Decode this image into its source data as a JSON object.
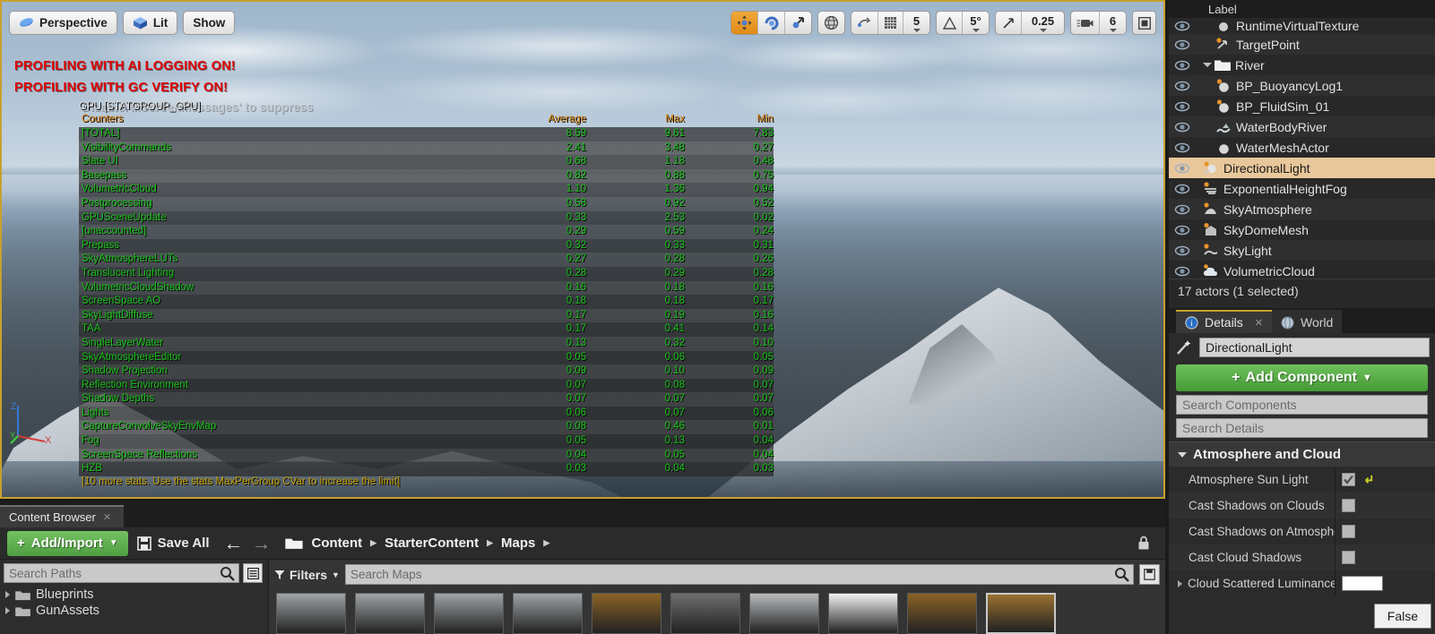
{
  "viewport": {
    "toolbar_left": [
      {
        "label": "Perspective",
        "icon": "camera-perspective-icon"
      },
      {
        "label": "Lit",
        "icon": "lit-cube-icon"
      },
      {
        "label": "Show",
        "icon": "show-icon"
      }
    ],
    "transform_tools": [
      {
        "name": "select-move-tool",
        "icon": "move-arrows-icon",
        "active": true
      },
      {
        "name": "rotate-tool",
        "icon": "rotate-icon",
        "active": false
      },
      {
        "name": "scale-tool",
        "icon": "scale-icon",
        "active": false
      }
    ],
    "coordinate_system": {
      "name": "world-coordinate-toggle",
      "icon": "globe-icon"
    },
    "surface_snap": {
      "name": "surface-snap-toggle",
      "icon": "surface-snap-icon"
    },
    "grid_snap": {
      "name": "grid-snap-toggle",
      "icon": "grid-icon",
      "value": "5"
    },
    "angle_snap": {
      "name": "angle-snap-toggle",
      "icon": "angle-icon",
      "value": "5°"
    },
    "scale_snap": {
      "name": "scale-snap-toggle",
      "icon": "scale-snap-icon",
      "value": "0.25"
    },
    "camera_speed": {
      "name": "camera-speed",
      "icon": "camera-speed-icon",
      "value": "6"
    },
    "maximize": {
      "name": "maximize-viewport-button",
      "icon": "maximize-icon"
    },
    "warnings": [
      "PROFILING WITH AI LOGGING ON!",
      "PROFILING WITH GC VERIFY ON!"
    ],
    "suppress_message": "'DisableAllScreenMessages' to suppress",
    "axis_labels": {
      "z": "Z",
      "y": "Y",
      "x": "X"
    }
  },
  "stats": {
    "title": "GPU [STATGROUP_GPU]",
    "columns": [
      "Counters",
      "Average",
      "Max",
      "Min"
    ],
    "rows": [
      {
        "name": "[TOTAL]",
        "average": "8.59",
        "max": "9.61",
        "min": "7.83"
      },
      {
        "name": "VisibilityCommands",
        "average": "2.41",
        "max": "3.48",
        "min": "0.27"
      },
      {
        "name": "Slate UI",
        "average": "0.68",
        "max": "1.18",
        "min": "0.48"
      },
      {
        "name": "Basepass",
        "average": "0.82",
        "max": "0.88",
        "min": "0.75"
      },
      {
        "name": "VolumetricCloud",
        "average": "1.10",
        "max": "1.36",
        "min": "0.94"
      },
      {
        "name": "Postprocessing",
        "average": "0.58",
        "max": "0.92",
        "min": "0.52"
      },
      {
        "name": "GPUSceneUpdate",
        "average": "0.33",
        "max": "2.53",
        "min": "0.02"
      },
      {
        "name": "[unaccounted]",
        "average": "0.29",
        "max": "0.59",
        "min": "0.24"
      },
      {
        "name": "Prepass",
        "average": "0.32",
        "max": "0.33",
        "min": "0.31"
      },
      {
        "name": "SkyAtmosphereLUTs",
        "average": "0.27",
        "max": "0.28",
        "min": "0.26"
      },
      {
        "name": "Translucent Lighting",
        "average": "0.28",
        "max": "0.29",
        "min": "0.28"
      },
      {
        "name": "VolumetricCloudShadow",
        "average": "0.16",
        "max": "0.18",
        "min": "0.16"
      },
      {
        "name": "ScreenSpace AO",
        "average": "0.18",
        "max": "0.18",
        "min": "0.17"
      },
      {
        "name": "SkyLightDiffuse",
        "average": "0.17",
        "max": "0.19",
        "min": "0.16"
      },
      {
        "name": "TAA",
        "average": "0.17",
        "max": "0.41",
        "min": "0.14"
      },
      {
        "name": "SingleLayerWater",
        "average": "0.13",
        "max": "0.32",
        "min": "0.10"
      },
      {
        "name": "SkyAtmosphereEditor",
        "average": "0.05",
        "max": "0.06",
        "min": "0.05"
      },
      {
        "name": "Shadow Projection",
        "average": "0.09",
        "max": "0.10",
        "min": "0.09"
      },
      {
        "name": "Reflection Environment",
        "average": "0.07",
        "max": "0.08",
        "min": "0.07"
      },
      {
        "name": "Shadow Depths",
        "average": "0.07",
        "max": "0.07",
        "min": "0.07"
      },
      {
        "name": "Lights",
        "average": "0.06",
        "max": "0.07",
        "min": "0.06"
      },
      {
        "name": "CaptureConvolveSkyEnvMap",
        "average": "0.08",
        "max": "0.46",
        "min": "0.01"
      },
      {
        "name": "Fog",
        "average": "0.05",
        "max": "0.13",
        "min": "0.04"
      },
      {
        "name": "ScreenSpace Reflections",
        "average": "0.04",
        "max": "0.05",
        "min": "0.04"
      },
      {
        "name": "HZB",
        "average": "0.03",
        "max": "0.04",
        "min": "0.03"
      }
    ],
    "footer": "[10 more stats. Use the stats MaxPerGroup CVar to increase the limit]"
  },
  "outliner": {
    "column_header": "Label",
    "items": [
      {
        "label": "RuntimeVirtualTexture",
        "icon": "mesh-icon",
        "indent": 2,
        "selected": false,
        "partial": true
      },
      {
        "label": "TargetPoint",
        "icon": "target-point-icon",
        "indent": 2,
        "selected": false
      },
      {
        "label": "River",
        "icon": "folder-icon",
        "indent": 1,
        "selected": false,
        "folder": true
      },
      {
        "label": "BP_BuoyancyLog1",
        "icon": "blueprint-icon",
        "indent": 2,
        "selected": false
      },
      {
        "label": "BP_FluidSim_01",
        "icon": "blueprint-icon",
        "indent": 2,
        "selected": false
      },
      {
        "label": "WaterBodyRiver",
        "icon": "water-body-icon",
        "indent": 2,
        "selected": false
      },
      {
        "label": "WaterMeshActor",
        "icon": "sphere-icon",
        "indent": 2,
        "selected": false
      },
      {
        "label": "DirectionalLight",
        "icon": "light-icon",
        "indent": 1,
        "selected": true
      },
      {
        "label": "ExponentialHeightFog",
        "icon": "fog-icon",
        "indent": 1,
        "selected": false
      },
      {
        "label": "SkyAtmosphere",
        "icon": "sky-atmosphere-icon",
        "indent": 1,
        "selected": false
      },
      {
        "label": "SkyDomeMesh",
        "icon": "dome-mesh-icon",
        "indent": 1,
        "selected": false
      },
      {
        "label": "SkyLight",
        "icon": "sky-light-icon",
        "indent": 1,
        "selected": false
      },
      {
        "label": "VolumetricCloud",
        "icon": "cloud-icon",
        "indent": 1,
        "selected": false
      }
    ],
    "status": "17 actors (1 selected)"
  },
  "details": {
    "tabs": [
      {
        "label": "Details",
        "icon": "details-info-icon",
        "active": true,
        "closable": true
      },
      {
        "label": "World",
        "icon": "world-settings-icon",
        "active": false,
        "closable": false
      }
    ],
    "actor_name": "DirectionalLight",
    "name_icon": "actor-wand-icon",
    "add_component_label": "Add Component",
    "search_components_placeholder": "Search Components",
    "search_details_placeholder": "Search Details",
    "category": "Atmosphere and Cloud",
    "properties": [
      {
        "label": "Atmosphere Sun Light",
        "type": "checkbox",
        "checked": true,
        "reverted": true
      },
      {
        "label": "Cast Shadows on Clouds",
        "type": "checkbox",
        "checked": false
      },
      {
        "label": "Cast Shadows on Atmosphere",
        "type": "checkbox",
        "checked": false
      },
      {
        "label": "Cast Cloud Shadows",
        "type": "checkbox",
        "checked": false
      },
      {
        "label": "Cloud Scattered Luminance",
        "type": "color",
        "expandable": true,
        "value": "#ffffff"
      }
    ],
    "tooltip": "False"
  },
  "content_browser": {
    "tab_label": "Content Browser",
    "add_import_label": "Add/Import",
    "save_all_label": "Save All",
    "breadcrumb": [
      "Content",
      "StarterContent",
      "Maps"
    ],
    "search_paths_placeholder": "Search Paths",
    "tree_items": [
      {
        "label": "Blueprints"
      },
      {
        "label": "GunAssets"
      }
    ],
    "filters_label": "Filters",
    "search_assets_placeholder": "Search Maps",
    "assets": [
      {
        "name": "map-thumb-1",
        "color": "#9fa3a6",
        "selected": false
      },
      {
        "name": "map-thumb-2",
        "color": "#9fa3a6",
        "selected": false
      },
      {
        "name": "map-thumb-3",
        "color": "#9fa3a6",
        "selected": false
      },
      {
        "name": "map-thumb-4",
        "color": "#9fa3a6",
        "selected": false
      },
      {
        "name": "map-thumb-5",
        "color": "#8a6326",
        "selected": false
      },
      {
        "name": "map-thumb-6",
        "color": "#6e6e6e",
        "selected": false
      },
      {
        "name": "map-thumb-7",
        "color": "#b9bbbd",
        "selected": false
      },
      {
        "name": "map-thumb-8",
        "color": "#f2f2f2",
        "selected": false
      },
      {
        "name": "map-thumb-9",
        "color": "#8a6326",
        "selected": false
      },
      {
        "name": "map-thumb-10",
        "color": "#9a7030",
        "selected": true
      }
    ]
  },
  "colors": {
    "stat_green": "#19c419",
    "stat_orange": "#e08a12",
    "warning_red": "#e00000",
    "accent_gold": "#c8a02e",
    "button_green": "#5aa84a",
    "selection": "#e8c79b"
  }
}
